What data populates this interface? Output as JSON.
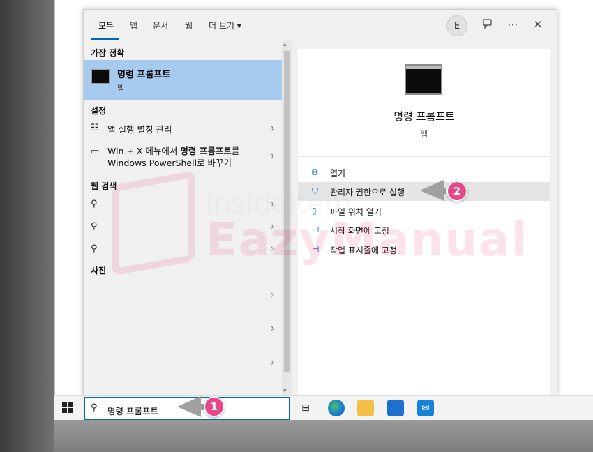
{
  "tabs": [
    "모두",
    "앱",
    "문서",
    "웹",
    "더 보기 ▾"
  ],
  "header": {
    "avatar_initial": "E",
    "feedback_icon": "feedback-icon",
    "more_icon": "⋯",
    "close_icon": "✕"
  },
  "left": {
    "best_match_header": "가장 정확",
    "best_match": {
      "title": "명령 프롬프트",
      "subtitle": "앱"
    },
    "settings_header": "설정",
    "settings": [
      {
        "label": "앱 실행 별칭 관리"
      },
      {
        "label_line1_prefix": "Win + X 메뉴에서 ",
        "label_line1_bold": "명령 프롬프트",
        "label_line1_suffix": "를",
        "label_line2": "Windows PowerShell로 바꾸기"
      }
    ],
    "web_header": "웹 검색",
    "photos_header": "사진"
  },
  "preview": {
    "title": "명령 프롬프트",
    "subtitle": "앱",
    "actions": [
      {
        "label": "열기",
        "icon": "open-icon"
      },
      {
        "label": "관리자 권한으로 실행",
        "icon": "shield-icon"
      },
      {
        "label": "파일 위치 열기",
        "icon": "file-location-icon"
      },
      {
        "label": "시작 화면에 고정",
        "icon": "pin-icon"
      },
      {
        "label": "작업 표시줄에 고정",
        "icon": "pin-icon"
      }
    ]
  },
  "watermark": {
    "small": "insideitem",
    "big": "EazyManual"
  },
  "taskbar": {
    "search_text": "명령 프롬프트"
  },
  "callouts": [
    "1",
    "2"
  ]
}
